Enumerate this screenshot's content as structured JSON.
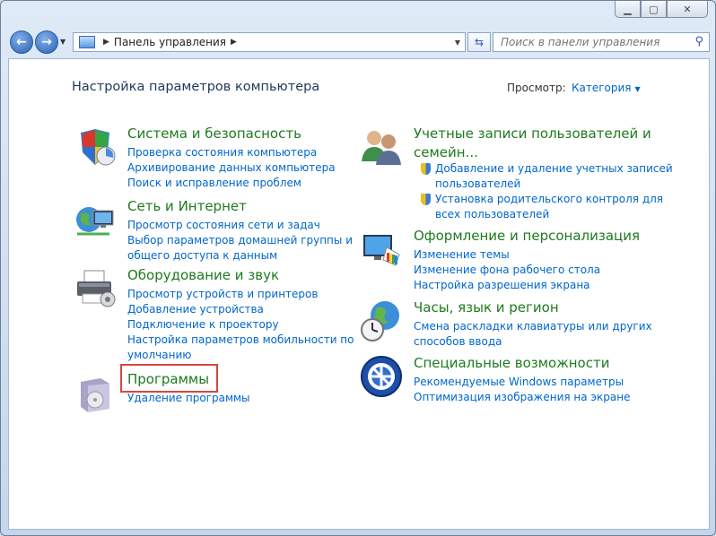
{
  "toolbar": {
    "address": "Панель управления",
    "search_placeholder": "Поиск в панели управления"
  },
  "header": {
    "title": "Настройка параметров компьютера",
    "view_label": "Просмотр:",
    "view_value": "Категория"
  },
  "categories": {
    "system": {
      "title": "Система и безопасность",
      "links": [
        "Проверка состояния компьютера",
        "Архивирование данных компьютера",
        "Поиск и исправление проблем"
      ]
    },
    "network": {
      "title": "Сеть и Интернет",
      "links": [
        "Просмотр состояния сети и задач",
        "Выбор параметров домашней группы и",
        "общего доступа к данным"
      ]
    },
    "hardware": {
      "title": "Оборудование и звук",
      "links": [
        "Просмотр устройств и принтеров",
        "Добавление устройства",
        "Подключение к проектору",
        "Настройка параметров мобильности по",
        "умолчанию"
      ]
    },
    "programs": {
      "title": "Программы",
      "links": [
        "Удаление программы"
      ]
    },
    "users": {
      "title_line1": "Учетные записи пользователей и",
      "title_line2": "семейн...",
      "links": [
        "Добавление и удаление учетных записей",
        "пользователей",
        "Установка родительского контроля для",
        "всех пользователей"
      ]
    },
    "appearance": {
      "title": "Оформление и персонализация",
      "links": [
        "Изменение темы",
        "Изменение фона рабочего стола",
        "Настройка разрешения экрана"
      ]
    },
    "clock": {
      "title": "Часы, язык и регион",
      "links": [
        "Смена раскладки клавиатуры или других",
        "способов ввода"
      ]
    },
    "ease": {
      "title": "Специальные возможности",
      "links": [
        "Рекомендуемые Windows параметры",
        "Оптимизация изображения на экране"
      ]
    }
  }
}
